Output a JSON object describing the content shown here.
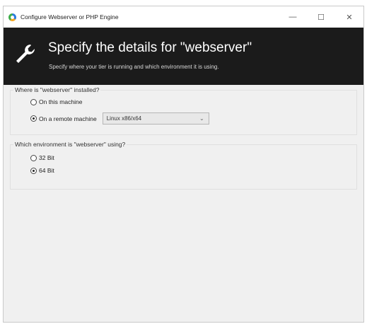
{
  "window": {
    "title": "Configure Webserver or PHP Engine",
    "minimize_glyph": "—",
    "maximize_glyph": "☐",
    "close_glyph": "✕"
  },
  "header": {
    "title": "Specify the details for \"webserver\"",
    "subtitle": "Specify where your tier is running and which environment it is using.",
    "icon": "wrench-icon"
  },
  "install_location": {
    "label": "Where is \"webserver\" installed?",
    "options": [
      {
        "label": "On this machine",
        "checked": false
      },
      {
        "label": "On a remote machine",
        "checked": true
      }
    ],
    "remote_platform": {
      "selected": "Linux x86/x64"
    }
  },
  "environment": {
    "label": "Which environment is \"webserver\" using?",
    "options": [
      {
        "label": "32 Bit",
        "checked": false
      },
      {
        "label": "64 Bit",
        "checked": true
      }
    ]
  }
}
